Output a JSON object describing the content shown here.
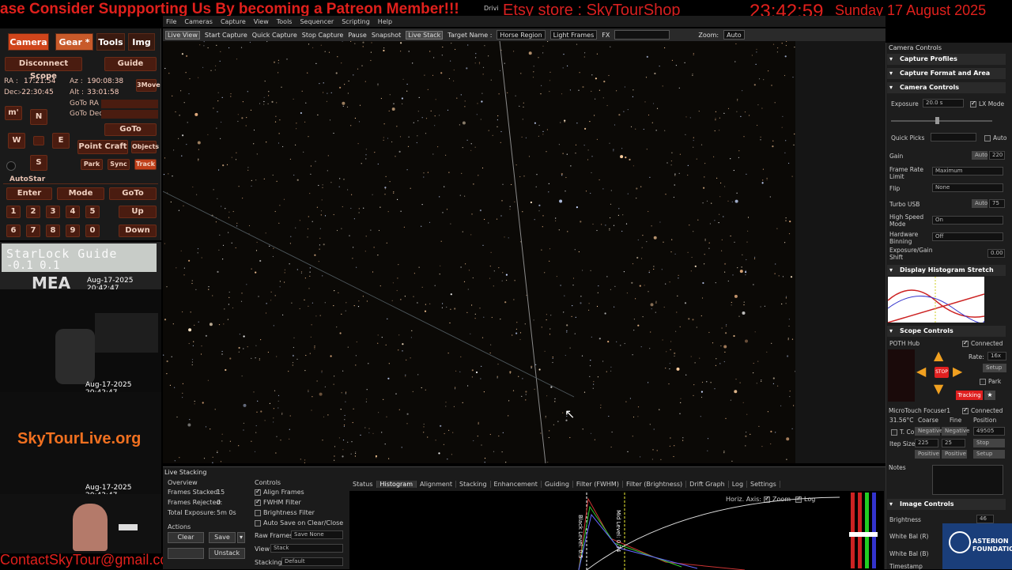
{
  "banner": {
    "patreon": "ase Consider Suppporting Us By becoming a Patreon Member!!!",
    "drive": "Drivi",
    "etsy": "Etsy store : SkyTourShop",
    "time": "23:42:59",
    "date": "Sunday 17 August 2025"
  },
  "menu": [
    "File",
    "Cameras",
    "Capture",
    "View",
    "Tools",
    "Sequencer",
    "Scripting",
    "Help"
  ],
  "toolbar": {
    "live_view": "Live View",
    "start_capture": "Start Capture",
    "quick_capture": "Quick Capture",
    "stop_capture": "Stop Capture",
    "pause": "Pause",
    "snapshot": "Snapshot",
    "live_stack": "Live Stack",
    "target_name_label": "Target Name :",
    "target_name": "Horse Region",
    "light_frames": "Light Frames",
    "fx": "FX",
    "zoom_label": "Zoom:",
    "zoom_value": "Auto"
  },
  "scope": {
    "tabs": [
      "Camera",
      "Gear *",
      "Tools",
      "Img"
    ],
    "disconnect": "Disconnect Scope",
    "guide": "Guide",
    "ra_label": "RA :",
    "ra": "17:21:54",
    "az_label": "Az :",
    "az": "190:08:38",
    "move": "3Move",
    "dec_label": "Dec:",
    "dec": "-22:30:45",
    "alt_label": "Alt :",
    "alt": "33:01:58",
    "goto_ra": "GoTo RA :",
    "goto_dec": "GoTo Dec:",
    "m": "m'",
    "n": "N",
    "w": "W",
    "e": "E",
    "s": "S",
    "goto": "GoTo",
    "point_craft": "Point Craft",
    "objects": "Objects",
    "park": "Park",
    "sync": "Sync",
    "track": "Track",
    "autostar": "AutoStar",
    "enter": "Enter",
    "mode": "Mode",
    "goto2": "GoTo",
    "up": "Up",
    "down": "Down",
    "keys_row1": [
      "1",
      "2",
      "3",
      "4",
      "5"
    ],
    "keys_row2": [
      "6",
      "7",
      "8",
      "9",
      "0"
    ]
  },
  "cams": {
    "lcd_line1": "StarLock Guide",
    "lcd_line2": "-0.1 0.1",
    "mea": "MEA",
    "stamp1": "Aug-17-2025 20:42:47",
    "stamp2": "Aug-17-2025 20:42:47",
    "stamp3": "Aug-17-2025 20:42:47",
    "skytour": "SkyTourLive.org"
  },
  "contact": "ContactSkyTour@gmail.com",
  "right": {
    "title": "Camera Controls",
    "sections": [
      "Capture Profiles",
      "Capture Format and Area",
      "Camera Controls",
      "Display Histogram Stretch",
      "Scope Controls",
      "Image Controls"
    ],
    "exposure_label": "Exposure",
    "exposure": "20.0 s",
    "lx_mode": "LX Mode",
    "quick_picks": "Quick Picks",
    "auto": "Auto",
    "gain_label": "Gain",
    "gain_auto": "Auto",
    "gain": "220",
    "frame_rate_label": "Frame Rate Limit",
    "frame_rate": "Maximum",
    "flip_label": "Flip",
    "flip": "None",
    "turbo_label": "Turbo USB",
    "turbo_auto": "Auto",
    "turbo": "75",
    "hs_label": "High Speed Mode",
    "hs": "On",
    "hb_label": "Hardware Binning",
    "hb": "Off",
    "egs_label": "Exposure/Gain Shift",
    "egs": "0.00",
    "poth": "POTH Hub",
    "connected": "Connected",
    "rate_label": "Rate:",
    "rate": "16x",
    "setup": "Setup",
    "stop": "STOP",
    "park": "Park",
    "tracking": "Tracking",
    "focuser": "MicroTouch Focuser1",
    "connected2": "Connected",
    "temp": "31.56°C",
    "coarse": "Coarse",
    "fine": "Fine",
    "position": "Position",
    "tco": "T. Co",
    "negative": "Negative",
    "negative2": "Negative",
    "pos_value": "49505",
    "step_label": "Itep Size",
    "step1": "225",
    "step2": "25",
    "stop2": "Stop",
    "positive": "Positive",
    "positive2": "Positive",
    "setup2": "Setup",
    "notes": "Notes",
    "brightness_label": "Brightness",
    "brightness": "46",
    "wb_r": "White Bal (R)",
    "wb_b": "White Bal (B)",
    "timestamp": "Timestamp"
  },
  "stack": {
    "title": "Live Stacking",
    "overview": "Overview",
    "frames_stacked_label": "Frames Stacked:",
    "frames_stacked": "15",
    "frames_rejected_label": "Frames Rejected:",
    "frames_rejected": "0",
    "total_exposure_label": "Total Exposure:",
    "total_exposure": "5m 0s",
    "actions": "Actions",
    "clear": "Clear",
    "save": "Save",
    "unstack": "Unstack",
    "controls": "Controls",
    "align": "Align Frames",
    "fwhm": "FWHM Filter",
    "brightness_filter": "Brightness Filter",
    "autosave": "Auto Save on Clear/Close",
    "raw_frames_label": "Raw Frames",
    "raw_frames": "Save None",
    "view_label": "View",
    "view": "Stack",
    "stacking_label": "Stacking",
    "stacking": "Default",
    "tabs": [
      "Status",
      "Histogram",
      "Alignment",
      "Stacking",
      "Enhancement",
      "Guiding",
      "Filter (FWHM)",
      "Filter (Brightness)",
      "Drift Graph",
      "Log",
      "Settings"
    ],
    "horiz_axis": "Horiz. Axis:",
    "zoom": "Zoom",
    "log": "Log",
    "black_level": "Black Level: 0.5",
    "mid_level": "Mid Level: 0.34"
  },
  "logo": "ASTERION FOUNDATION"
}
